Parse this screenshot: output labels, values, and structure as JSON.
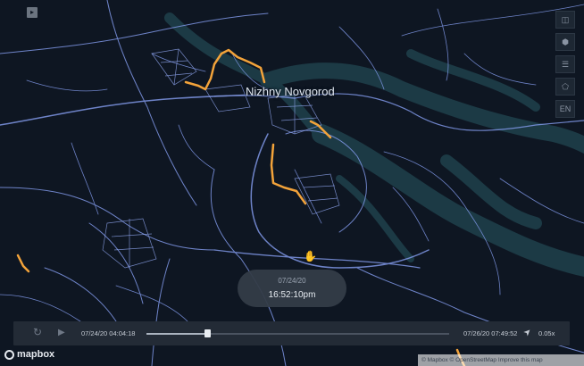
{
  "map": {
    "city_label": "Nizhny Novgorod",
    "colors": {
      "background": "#0e1622",
      "river": "#1e3d48",
      "roads": "#7f97e6",
      "trips": "#f3a33a"
    }
  },
  "top_left_button": {
    "icon": "chevron-right-icon",
    "glyph": "▸"
  },
  "right_toolbar": [
    {
      "name": "layers-button",
      "icon": "split-panel-icon",
      "glyph": "◫"
    },
    {
      "name": "3d-view-button",
      "icon": "cube-icon",
      "glyph": "⬢"
    },
    {
      "name": "data-table-button",
      "icon": "table-icon",
      "glyph": "☰"
    },
    {
      "name": "draw-polygon-button",
      "icon": "polygon-icon",
      "glyph": "⬠"
    },
    {
      "name": "language-button",
      "icon": "language-icon",
      "label": "EN"
    }
  ],
  "time_bubble": {
    "date": "07/24/20",
    "time": "16:52:10pm"
  },
  "playback": {
    "replay_icon": "↻",
    "play_icon": "▶",
    "start_time": "07/24/20 04:04:18",
    "end_time": "07/26/20 07:49:52",
    "speed_icon": "➤",
    "speed": "0.05x",
    "progress": 0.2
  },
  "footer": {
    "logo_text": "mapbox",
    "attribution": "© Mapbox © OpenStreetMap Improve this map"
  }
}
